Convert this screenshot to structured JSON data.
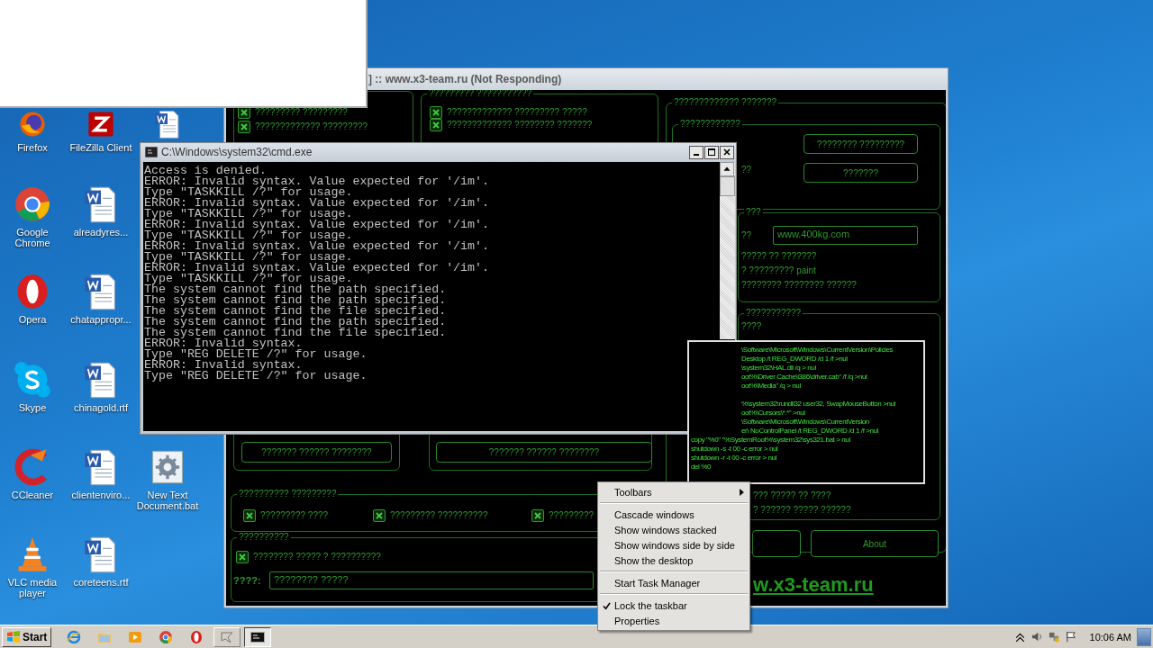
{
  "desktop_icons": [
    {
      "label": "Firefox",
      "kind": "firefox"
    },
    {
      "label": "Google Chrome",
      "kind": "chrome"
    },
    {
      "label": "Opera",
      "kind": "opera"
    },
    {
      "label": "Skype",
      "kind": "skype"
    },
    {
      "label": "CCleaner",
      "kind": "ccleaner"
    },
    {
      "label": "VLC media player",
      "kind": "vlc"
    },
    {
      "label": "FileZilla Client",
      "kind": "filezilla"
    },
    {
      "label": "alreadyres...",
      "kind": "document"
    },
    {
      "label": "chatappropr...",
      "kind": "document"
    },
    {
      "label": "chinagold.rtf",
      "kind": "document"
    },
    {
      "label": "clientenviro...",
      "kind": "document"
    },
    {
      "label": "coreteens.rtf",
      "kind": "document"
    },
    {
      "kind": "document"
    },
    {
      "label": "New Text Document.bat",
      "kind": "batch"
    }
  ],
  "app_window": {
    "title": "] :: www.x3-team.ru (Not Responding)",
    "items": [
      {
        "kind": "group"
      },
      {
        "kind": "checkbox",
        "label": "????????? ?????????",
        "checked": true
      },
      {
        "kind": "checkbox",
        "label": "????????????? ?????????",
        "checked": true
      },
      {
        "kind": "group",
        "legend": "????????? ???????????"
      },
      {
        "kind": "checkbox",
        "label": "????????????? ????????? ?????",
        "checked": true
      },
      {
        "kind": "checkbox",
        "label": "????????????? ???????? ???????",
        "checked": true
      },
      {
        "kind": "group",
        "legend": "????????????? ???????"
      },
      {
        "kind": "group",
        "legend": "????????????"
      },
      {
        "kind": "text",
        "text": "??"
      },
      {
        "kind": "button",
        "label": "???????? ?????????"
      },
      {
        "kind": "button",
        "label": "???????"
      },
      {
        "kind": "group",
        "legend": "???"
      },
      {
        "kind": "text",
        "text": "??"
      },
      {
        "kind": "field",
        "value": "www.400kg.com"
      },
      {
        "kind": "text",
        "text": "????? ?? ???????"
      },
      {
        "kind": "text",
        "text": "? ????????? paint"
      },
      {
        "kind": "text",
        "text": "???????? ???????? ??????"
      },
      {
        "kind": "group",
        "legend": "???????????"
      },
      {
        "kind": "text",
        "text": "????"
      },
      {
        "kind": "text",
        "text": "??? ????? ?? ????"
      },
      {
        "kind": "text",
        "text": "? ?????? ????? ??????"
      },
      {
        "kind": "button"
      },
      {
        "kind": "button",
        "label": "About"
      },
      {
        "kind": "link",
        "text": "w.x3-team.ru"
      },
      {
        "kind": "group"
      },
      {
        "kind": "button",
        "label": "??????? ?????? ????????"
      },
      {
        "kind": "group"
      },
      {
        "kind": "button",
        "label": "??????? ?????? ????????"
      },
      {
        "kind": "group",
        "legend": "?????????? ?????????"
      },
      {
        "kind": "checkbox",
        "label": "????????? ????",
        "checked": true
      },
      {
        "kind": "checkbox",
        "label": "????????? ??????????",
        "checked": true
      },
      {
        "kind": "checkbox",
        "label": "?????????",
        "checked": true
      },
      {
        "kind": "group",
        "legend": "??????????"
      },
      {
        "kind": "checkbox",
        "label": "???????? ????? ? ??????????",
        "checked": true
      },
      {
        "kind": "label",
        "text": "????:"
      },
      {
        "kind": "field",
        "value": "???????? ?????"
      }
    ]
  },
  "cmd_window": {
    "title": "C:\\Windows\\system32\\cmd.exe",
    "lines": [
      "Access is denied.",
      "ERROR: Invalid syntax. Value expected for '/im'.",
      "Type \"TASKKILL /?\" for usage.",
      "ERROR: Invalid syntax. Value expected for '/im'.",
      "Type \"TASKKILL /?\" for usage.",
      "ERROR: Invalid syntax. Value expected for '/im'.",
      "Type \"TASKKILL /?\" for usage.",
      "ERROR: Invalid syntax. Value expected for '/im'.",
      "Type \"TASKKILL /?\" for usage.",
      "ERROR: Invalid syntax. Value expected for '/im'.",
      "Type \"TASKKILL /?\" for usage.",
      "The system cannot find the path specified.",
      "The system cannot find the path specified.",
      "The system cannot find the file specified.",
      "The system cannot find the path specified.",
      "The system cannot find the file specified.",
      "ERROR: Invalid syntax.",
      "Type \"REG DELETE /?\" for usage.",
      "ERROR: Invalid syntax.",
      "Type \"REG DELETE /?\" for usage."
    ]
  },
  "script_popup": {
    "blocks": [
      [
        {
          "text": "\\Software\\Microsoft\\Windows\\CurrentVersion\\Policies",
          "indented": true
        },
        {
          "text": "Desktop /t REG_DWORD /d 1 /f >nul",
          "indented": true
        },
        {
          "text": "\\system32\\HAL.dll /q > nul",
          "indented": true
        },
        {
          "text": "oot%\\Driver Cache\\i386\\driver.cab\" /f /q >nul",
          "indented": true
        },
        {
          "text": "oot%\\Media\" /q > nul",
          "indented": true
        }
      ],
      [
        {
          "text": "%\\system32\\rundll32 user32, SwapMouseButton >nul",
          "indented": true
        },
        {
          "text": "oot%\\Cursors\\*.*\" >nul",
          "indented": true
        },
        {
          "text": "\\Software\\Microsoft\\Windows\\CurrentVersion",
          "indented": true
        },
        {
          "text": "er\\ NoControlPanel /t REG_DWORD /d 1 /f >nul",
          "indented": true
        },
        {
          "text": "copy \"%0\" \"%SystemRoot%\\system32\\sys321.bat > nul",
          "indented": false
        },
        {
          "text": "shutdown -s -t 00 -c error > nul",
          "indented": false
        },
        {
          "text": "shutdown -r -t 00 -c error > nul",
          "indented": false
        },
        {
          "text": "del %0",
          "indented": false
        }
      ]
    ]
  },
  "context_menu": {
    "items": [
      {
        "kind": "submenu",
        "label": "Toolbars",
        "checked": false
      },
      {
        "kind": "separator"
      },
      {
        "kind": "item",
        "label": "Cascade windows",
        "checked": false
      },
      {
        "kind": "item",
        "label": "Show windows stacked",
        "checked": false
      },
      {
        "kind": "item",
        "label": "Show windows side by side",
        "checked": false
      },
      {
        "kind": "item",
        "label": "Show the desktop",
        "checked": false
      },
      {
        "kind": "separator"
      },
      {
        "kind": "item",
        "label": "Start Task Manager",
        "checked": false
      },
      {
        "kind": "separator"
      },
      {
        "kind": "item",
        "label": "Lock the taskbar",
        "checked": true
      },
      {
        "kind": "item",
        "label": "Properties",
        "checked": false
      }
    ]
  },
  "taskbar": {
    "start": "Start",
    "buttons": [
      {
        "kind": "ie",
        "selected": false
      },
      {
        "kind": "folder",
        "selected": false
      },
      {
        "kind": "player",
        "selected": false
      },
      {
        "kind": "chrome",
        "selected": false
      },
      {
        "kind": "opera",
        "selected": false
      },
      {
        "kind": "hung-app",
        "selected": false
      },
      {
        "kind": "console",
        "selected": true
      }
    ],
    "clock": "10:06 AM"
  }
}
